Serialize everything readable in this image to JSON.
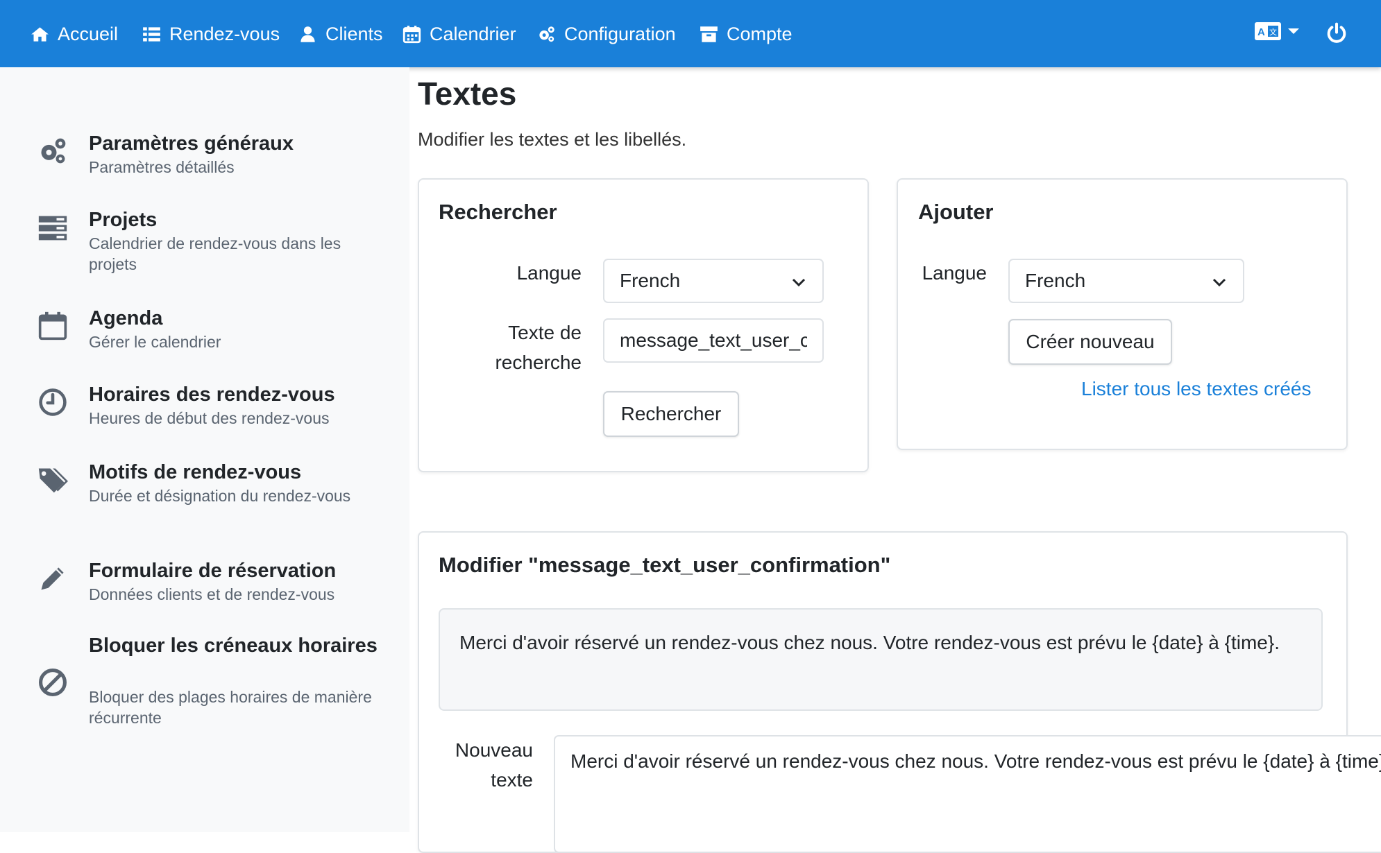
{
  "navbar": {
    "items": [
      {
        "label": "Accueil",
        "icon": "home-icon"
      },
      {
        "label": "Rendez-vous",
        "icon": "list-icon"
      },
      {
        "label": "Clients",
        "icon": "user-icon"
      },
      {
        "label": "Calendrier",
        "icon": "calendar-icon"
      },
      {
        "label": "Configuration",
        "icon": "cogs-icon"
      },
      {
        "label": "Compte",
        "icon": "archive-icon"
      }
    ],
    "language_icon": "translate-icon",
    "power_icon": "power-icon"
  },
  "sidebar": {
    "items": [
      {
        "title": "Paramètres généraux",
        "desc": "Paramètres détaillés",
        "icon": "cogs-icon"
      },
      {
        "title": "Projets",
        "desc": "Calendrier de rendez-vous dans les projets",
        "icon": "server-icon"
      },
      {
        "title": "Agenda",
        "desc": "Gérer le calendrier",
        "icon": "calendar-icon"
      },
      {
        "title": "Horaires des rendez-vous",
        "desc": "Heures de début des rendez-vous",
        "icon": "clock-icon"
      },
      {
        "title": "Motifs de rendez-vous",
        "desc": "Durée et désignation du rendez-vous",
        "icon": "tags-icon"
      },
      {
        "title": "Formulaire de réservation",
        "desc": "Données clients et de rendez-vous",
        "icon": "pencil-icon"
      },
      {
        "title": "Bloquer les créneaux horaires",
        "desc": "Bloquer des plages horaires de manière récurrente",
        "icon": "ban-icon"
      }
    ]
  },
  "page": {
    "title": "Textes",
    "subtitle": "Modifier les textes et les libellés."
  },
  "search_card": {
    "title": "Rechercher",
    "language_label": "Langue",
    "language_value": "French",
    "search_label_1": "Texte de",
    "search_label_2": "recherche",
    "search_value": "message_text_user_confirmation",
    "button": "Rechercher"
  },
  "add_card": {
    "title": "Ajouter",
    "language_label": "Langue",
    "language_value": "French",
    "create_button": "Créer nouveau",
    "list_link": "Lister tous les textes créés"
  },
  "edit_card": {
    "title": "Modifier \"message_text_user_confirmation\"",
    "current_text": "Merci d'avoir réservé un rendez-vous chez nous. Votre rendez-vous est prévu le {date} à {time}.",
    "new_text_label_1": "Nouveau",
    "new_text_label_2": "texte",
    "new_text_value": "Merci d'avoir réservé un rendez-vous chez nous. Votre rendez-vous est prévu le {date} à {time}."
  },
  "colors": {
    "primary": "#1a80d9",
    "sidebar_bg": "#f8f9fa",
    "icon_gray": "#5a6470"
  }
}
